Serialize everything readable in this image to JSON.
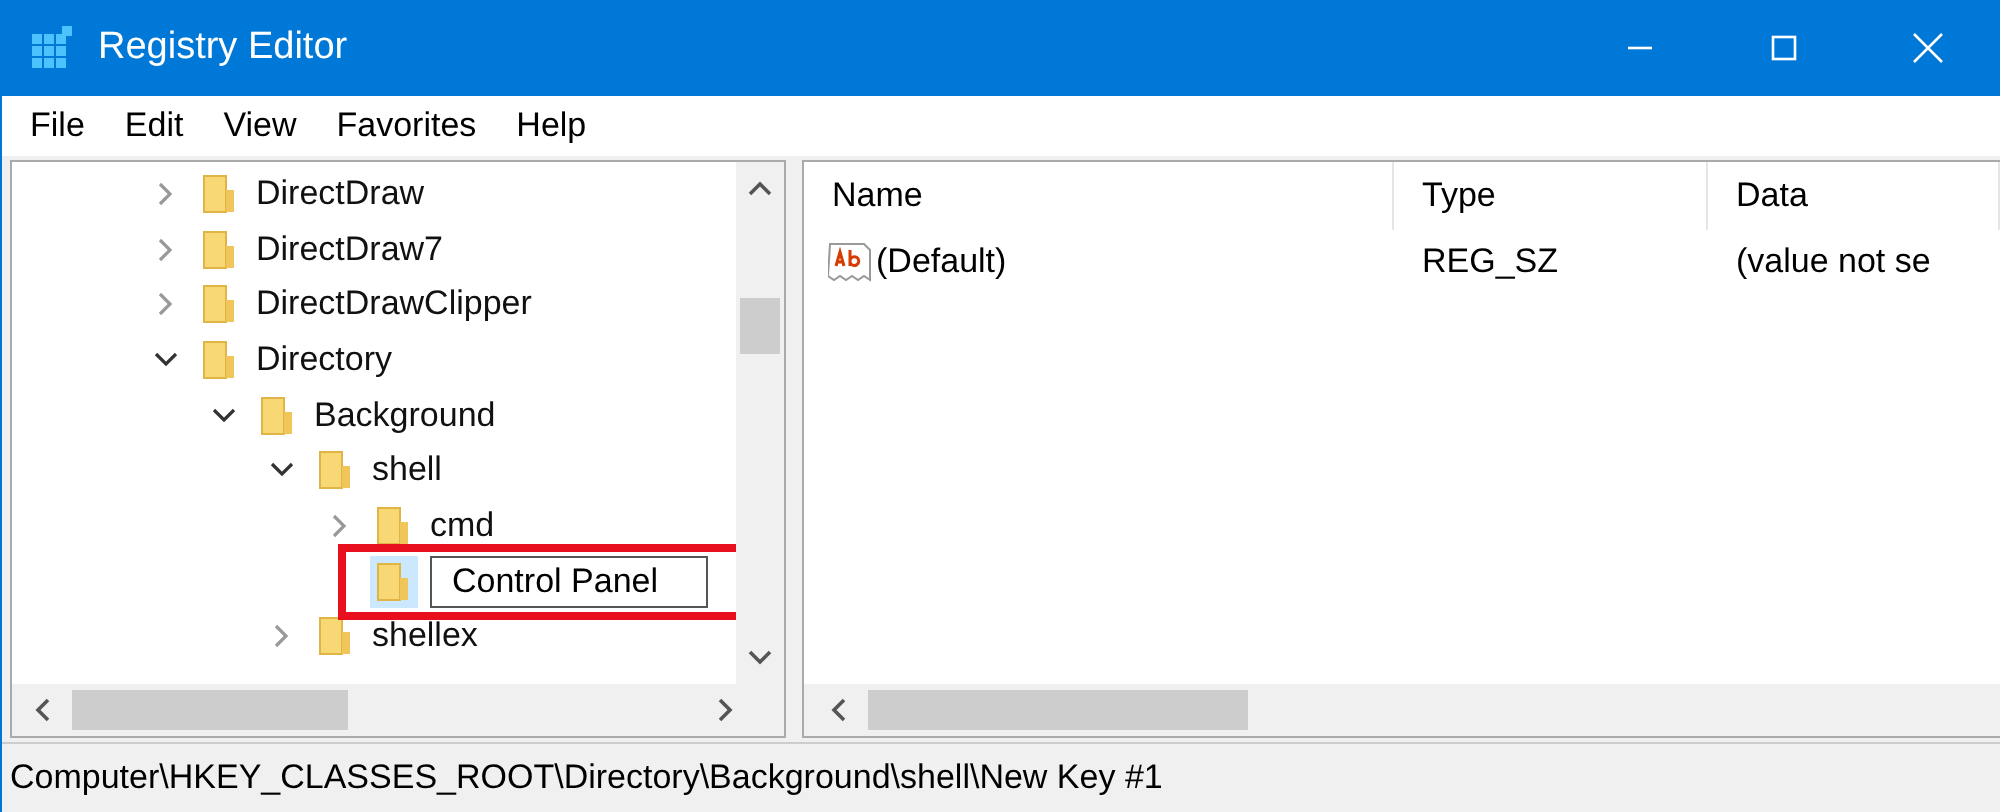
{
  "window": {
    "title": "Registry Editor"
  },
  "menu": [
    "File",
    "Edit",
    "View",
    "Favorites",
    "Help"
  ],
  "tree": [
    {
      "label": "DirectDraw",
      "has_children": true,
      "expanded": false,
      "selected": false,
      "editing": false
    },
    {
      "label": "DirectDraw7",
      "has_children": true,
      "expanded": false,
      "selected": false,
      "editing": false
    },
    {
      "label": "DirectDrawClipper",
      "has_children": true,
      "expanded": false,
      "selected": false,
      "editing": false
    },
    {
      "label": "Directory",
      "has_children": true,
      "expanded": true,
      "selected": false,
      "editing": false,
      "children": [
        {
          "label": "Background",
          "has_children": true,
          "expanded": true,
          "selected": false,
          "editing": false,
          "children": [
            {
              "label": "shell",
              "has_children": true,
              "expanded": true,
              "selected": false,
              "editing": false,
              "children": [
                {
                  "label": "cmd",
                  "has_children": true,
                  "expanded": false,
                  "selected": false,
                  "editing": false
                },
                {
                  "label": "Control Panel",
                  "has_children": false,
                  "selected": true,
                  "editing": true
                }
              ]
            },
            {
              "label": "shellex",
              "has_children": true,
              "expanded": false,
              "selected": false,
              "editing": false
            }
          ]
        }
      ]
    }
  ],
  "values_table": {
    "columns": [
      "Name",
      "Type",
      "Data"
    ],
    "rows": [
      {
        "name": "(Default)",
        "type": "REG_SZ",
        "data": "(value not se"
      }
    ]
  },
  "status_bar": "Computer\\HKEY_CLASSES_ROOT\\Directory\\Background\\shell\\New Key #1"
}
